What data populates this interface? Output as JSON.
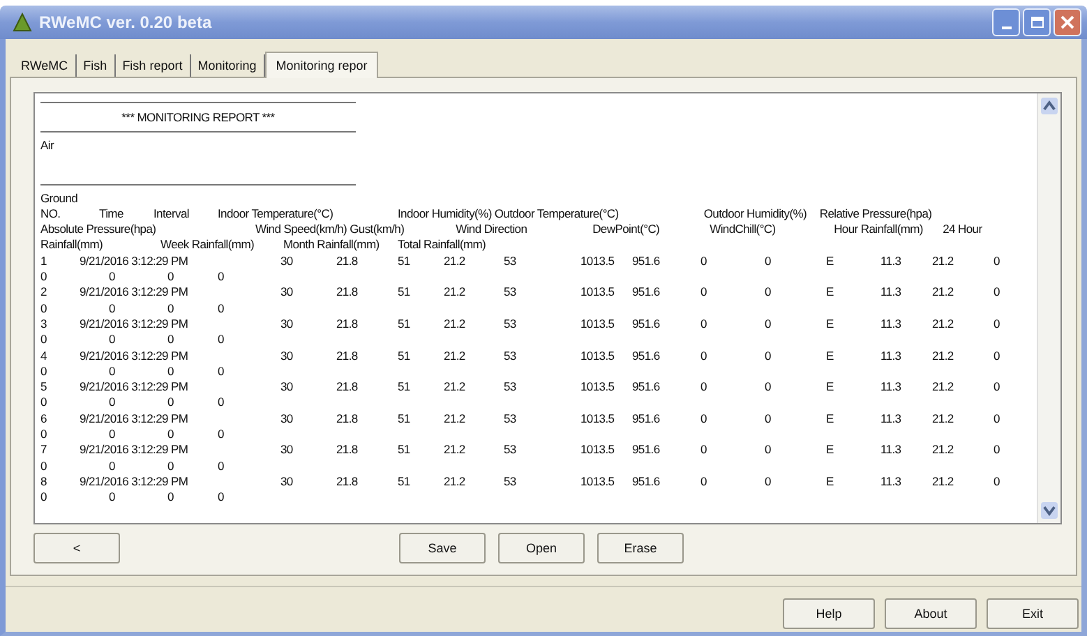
{
  "window": {
    "title": "RWeMC ver. 0.20 beta"
  },
  "tabs": [
    {
      "label": "RWeMC",
      "selected": false
    },
    {
      "label": "Fish",
      "selected": false
    },
    {
      "label": "Fish report",
      "selected": false
    },
    {
      "label": "Monitoring",
      "selected": false
    },
    {
      "label": "Monitoring repor",
      "selected": true
    }
  ],
  "report": {
    "heading": "*** MONITORING REPORT ***",
    "air_label": "Air",
    "ground_label": "Ground",
    "header_lines": [
      [
        "NO.",
        "Time",
        "Interval",
        "Indoor Temperature(°C)",
        "Indoor Humidity(%)",
        "Outdoor Temperature(°C)",
        "Outdoor Humidity(%)",
        "Relative Pressure(hpa)"
      ],
      [
        "Absolute Pressure(hpa)",
        "Wind Speed(km/h)",
        "Gust(km/h)",
        "Wind Direction",
        "DewPoint(°C)",
        "WindChill(°C)",
        "Hour Rainfall(mm)",
        "24 Hour"
      ],
      [
        "Rainfall(mm)",
        "Week Rainfall(mm)",
        "Month Rainfall(mm)",
        "Total Rainfall(mm)"
      ]
    ],
    "rows": [
      {
        "no": "1",
        "time": "9/21/2016 3:12:29 PM",
        "values": [
          "30",
          "21.8",
          "51",
          "21.2",
          "53",
          "1013.5",
          "951.6",
          "0",
          "0",
          "E",
          "11.3",
          "21.2",
          "0"
        ],
        "continuation": [
          "0",
          "0",
          "0",
          "0"
        ]
      },
      {
        "no": "2",
        "time": "9/21/2016 3:12:29 PM",
        "values": [
          "30",
          "21.8",
          "51",
          "21.2",
          "53",
          "1013.5",
          "951.6",
          "0",
          "0",
          "E",
          "11.3",
          "21.2",
          "0"
        ],
        "continuation": [
          "0",
          "0",
          "0",
          "0"
        ]
      },
      {
        "no": "3",
        "time": "9/21/2016 3:12:29 PM",
        "values": [
          "30",
          "21.8",
          "51",
          "21.2",
          "53",
          "1013.5",
          "951.6",
          "0",
          "0",
          "E",
          "11.3",
          "21.2",
          "0"
        ],
        "continuation": [
          "0",
          "0",
          "0",
          "0"
        ]
      },
      {
        "no": "4",
        "time": "9/21/2016 3:12:29 PM",
        "values": [
          "30",
          "21.8",
          "51",
          "21.2",
          "53",
          "1013.5",
          "951.6",
          "0",
          "0",
          "E",
          "11.3",
          "21.2",
          "0"
        ],
        "continuation": [
          "0",
          "0",
          "0",
          "0"
        ]
      },
      {
        "no": "5",
        "time": "9/21/2016 3:12:29 PM",
        "values": [
          "30",
          "21.8",
          "51",
          "21.2",
          "53",
          "1013.5",
          "951.6",
          "0",
          "0",
          "E",
          "11.3",
          "21.2",
          "0"
        ],
        "continuation": [
          "0",
          "0",
          "0",
          "0"
        ]
      },
      {
        "no": "6",
        "time": "9/21/2016 3:12:29 PM",
        "values": [
          "30",
          "21.8",
          "51",
          "21.2",
          "53",
          "1013.5",
          "951.6",
          "0",
          "0",
          "E",
          "11.3",
          "21.2",
          "0"
        ],
        "continuation": [
          "0",
          "0",
          "0",
          "0"
        ]
      },
      {
        "no": "7",
        "time": "9/21/2016 3:12:29 PM",
        "values": [
          "30",
          "21.8",
          "51",
          "21.2",
          "53",
          "1013.5",
          "951.6",
          "0",
          "0",
          "E",
          "11.3",
          "21.2",
          "0"
        ],
        "continuation": [
          "0",
          "0",
          "0",
          "0"
        ]
      },
      {
        "no": "8",
        "time": "9/21/2016 3:12:29 PM",
        "values": [
          "30",
          "21.8",
          "51",
          "21.2",
          "53",
          "1013.5",
          "951.6",
          "0",
          "0",
          "E",
          "11.3",
          "21.2",
          "0"
        ],
        "continuation": [
          "0",
          "0",
          "0",
          "0"
        ]
      }
    ]
  },
  "nav_button": "<",
  "actions": [
    "Save",
    "Open",
    "Erase"
  ],
  "footer_buttons": [
    "Help",
    "About",
    "Exit"
  ]
}
